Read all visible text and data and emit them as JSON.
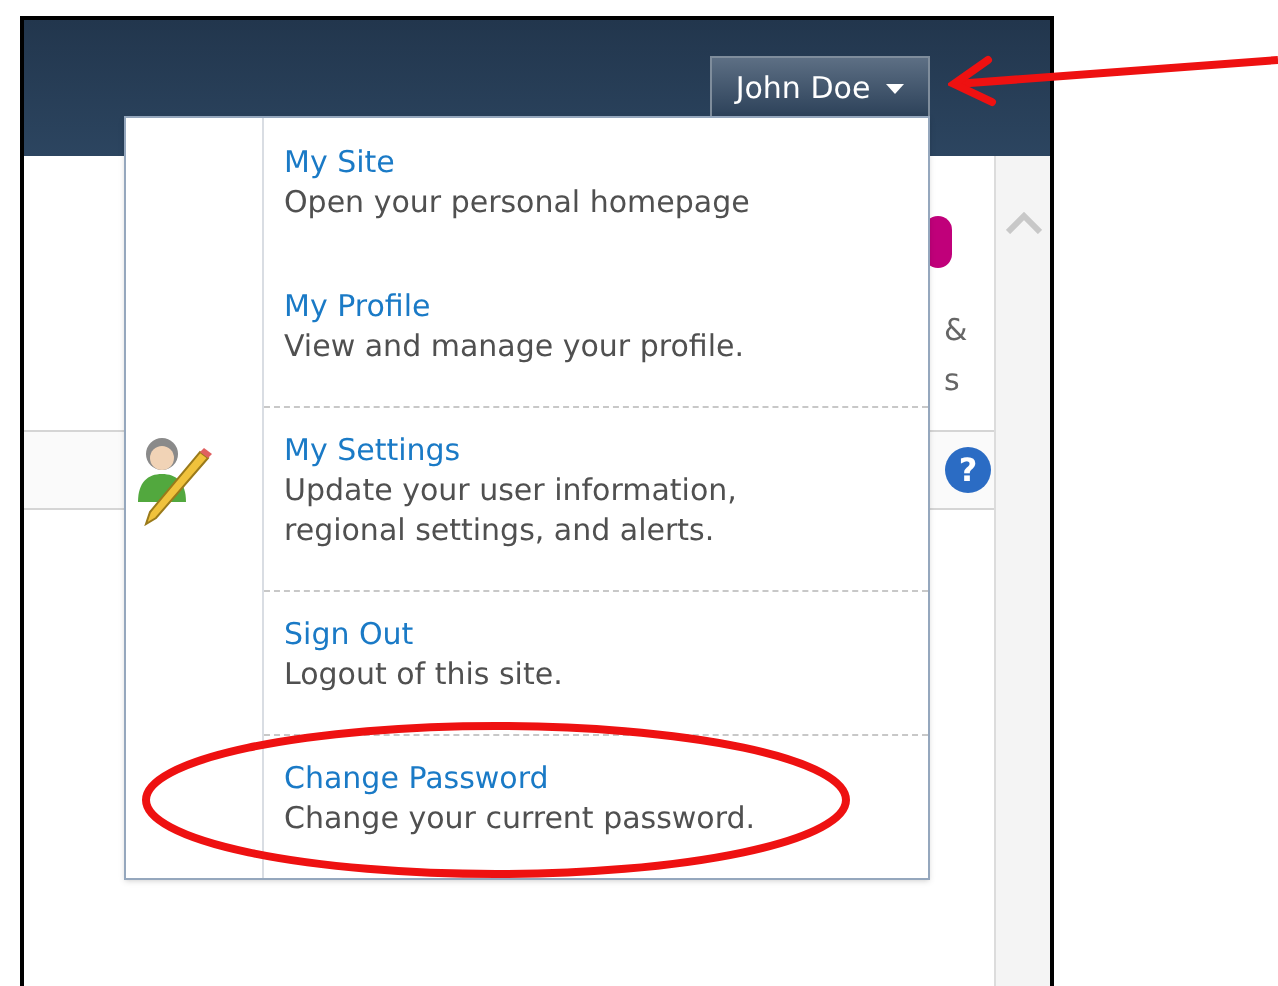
{
  "user_button": {
    "label": "John Doe",
    "expanded": true
  },
  "menu": {
    "items": [
      {
        "title": "My Site",
        "description": "Open your personal homepage",
        "divider_above": false,
        "icon": false,
        "circled": false
      },
      {
        "title": "My Profile",
        "description": "View and manage your profile.",
        "divider_above": false,
        "icon": false,
        "circled": false
      },
      {
        "title": "My Settings",
        "description": "Update your user information, regional settings, and alerts.",
        "divider_above": true,
        "icon": true,
        "circled": false
      },
      {
        "title": "Sign Out",
        "description": "Logout of this site.",
        "divider_above": true,
        "icon": false,
        "circled": false
      },
      {
        "title": "Change Password",
        "description": "Change your current password.",
        "divider_above": true,
        "icon": false,
        "circled": true
      }
    ]
  },
  "background_fragments": [
    "&",
    "s"
  ],
  "help_button": {
    "label": "?"
  }
}
